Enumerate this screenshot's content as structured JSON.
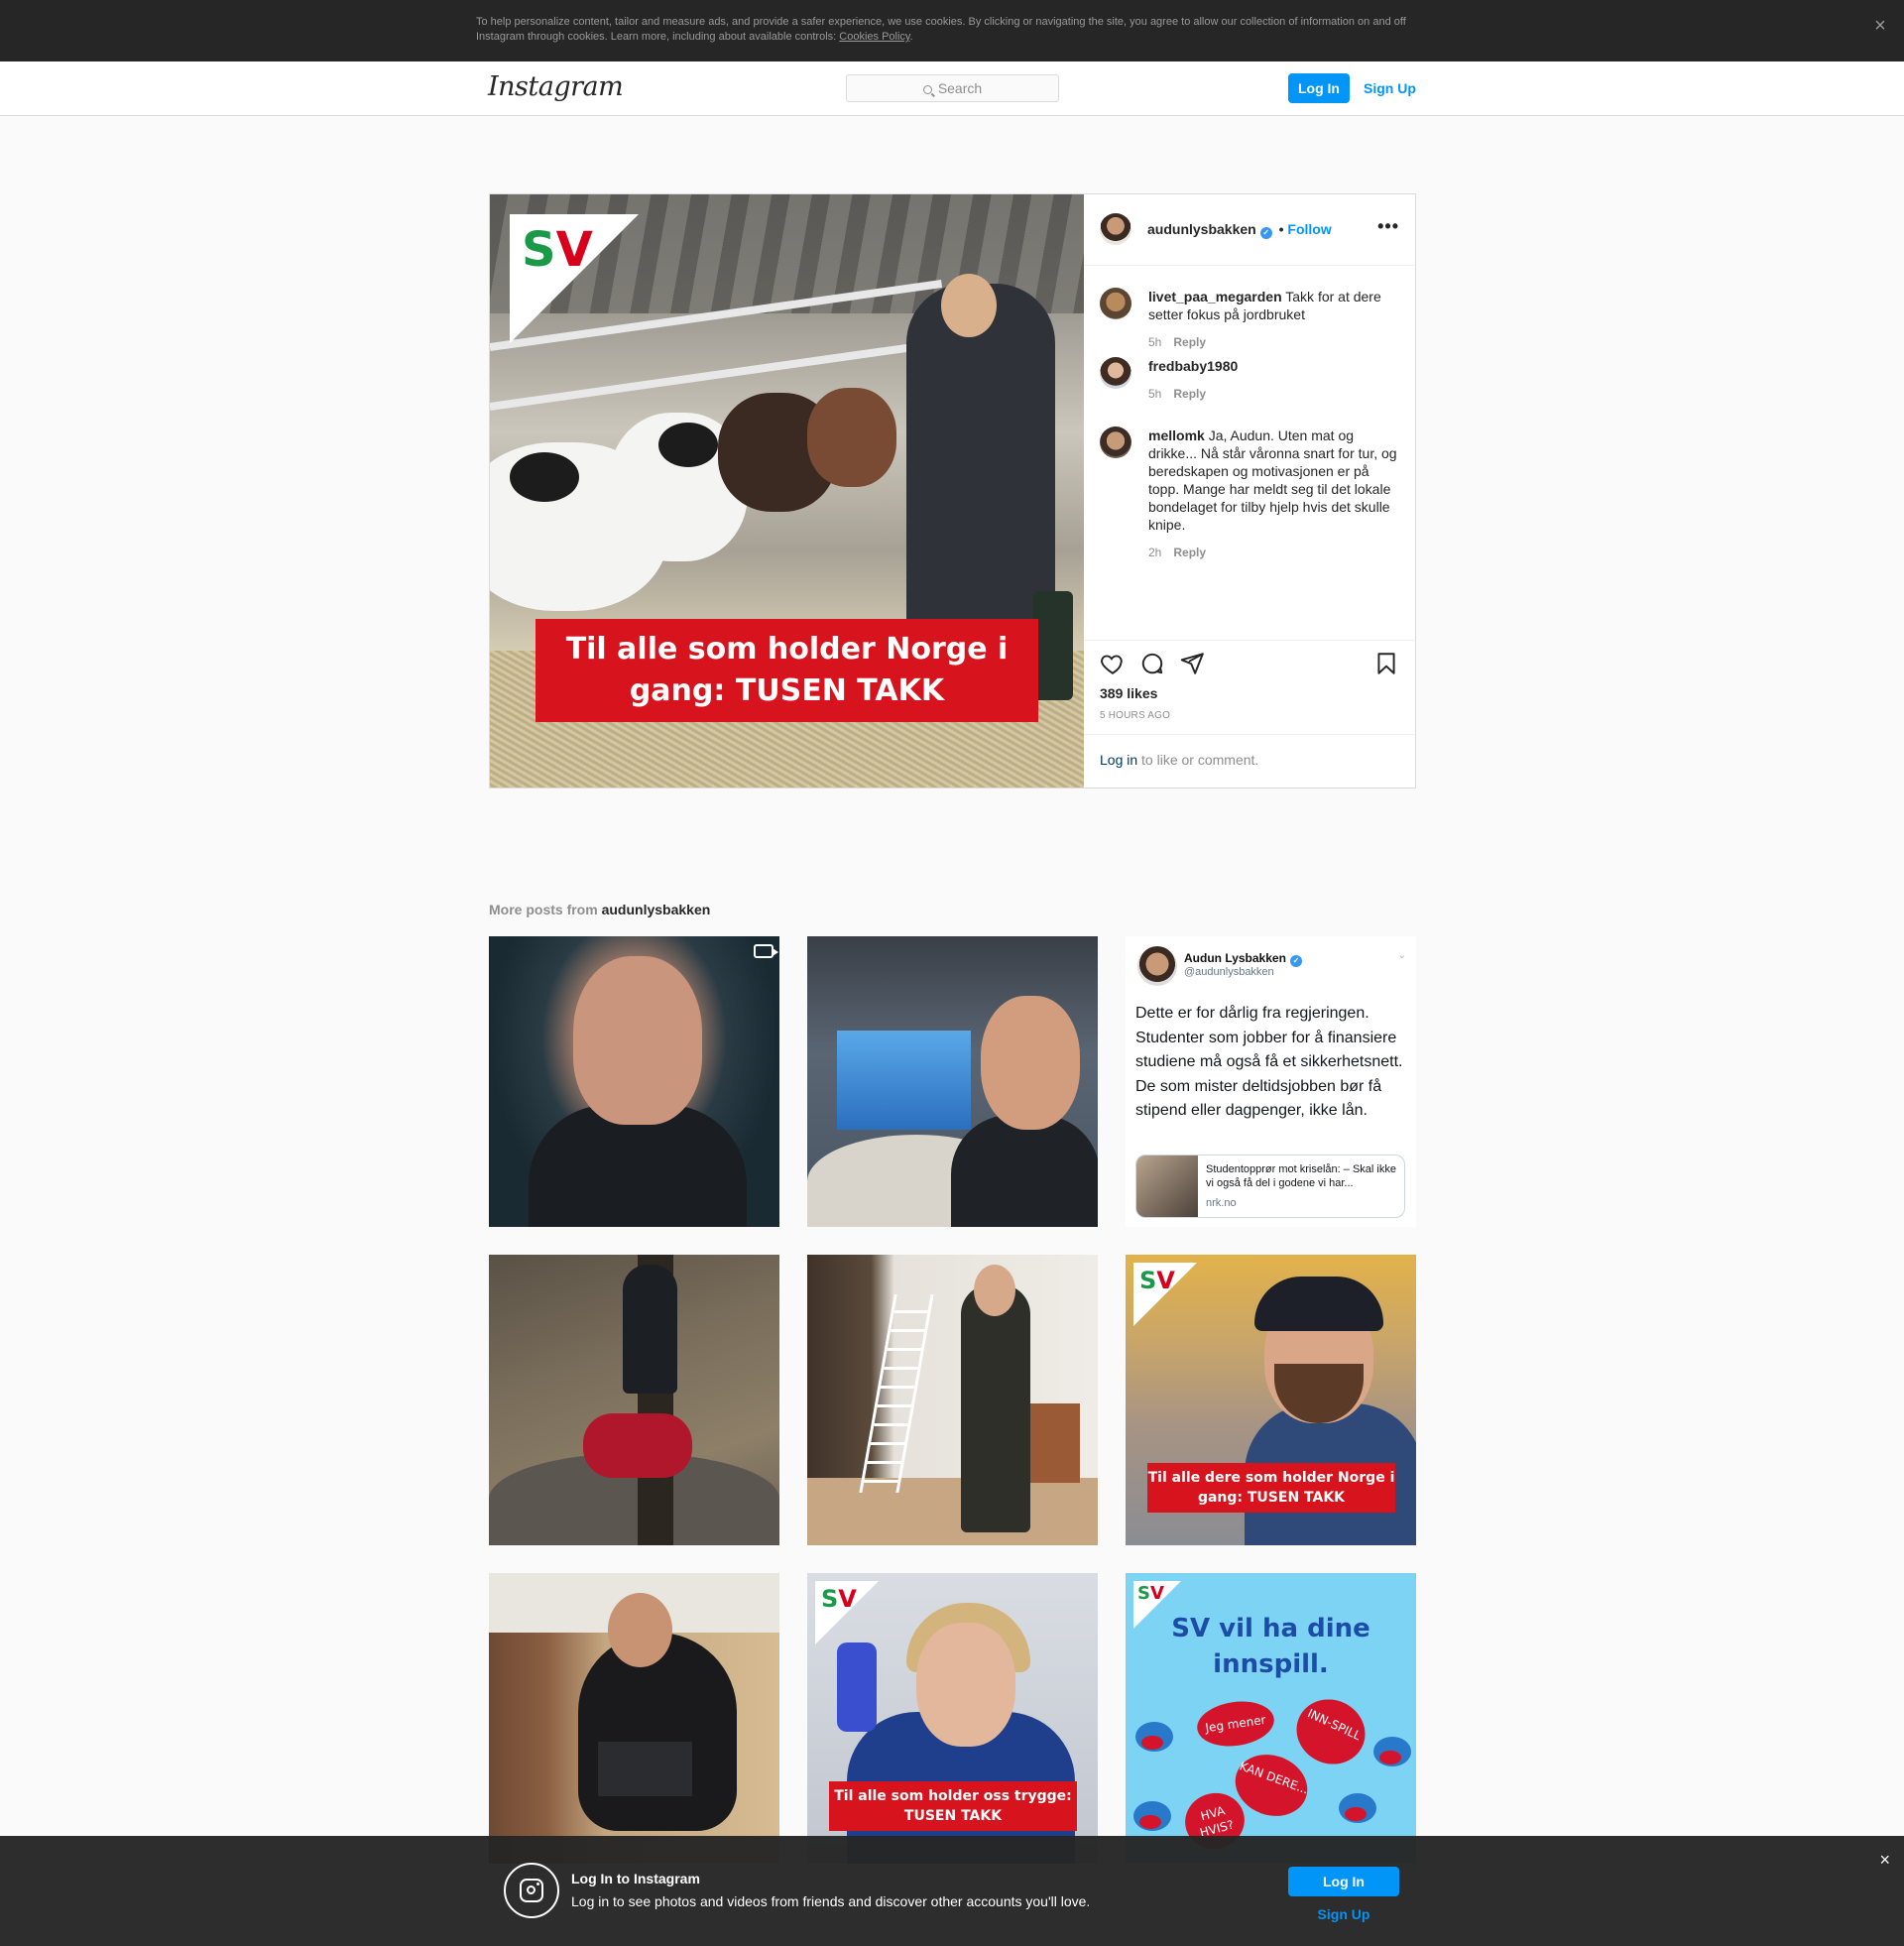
{
  "cookie_banner": {
    "text": "To help personalize content, tailor and measure ads, and provide a safer experience, we use cookies. By clicking or navigating the site, you agree to allow our collection of information on and off Instagram through cookies. Learn more, including about available controls: ",
    "link": "Cookies Policy",
    "suffix": ".",
    "close": "×"
  },
  "header": {
    "logo": "Instagram",
    "search_placeholder": "Search",
    "login": "Log In",
    "signup": "Sign Up"
  },
  "post": {
    "image_banner": "Til alle som holder Norge i gang: TUSEN TAKK",
    "author": "audunlysbakken",
    "verified_icon": "✓",
    "follow_sep": "•",
    "follow": "Follow",
    "more": "•••",
    "comments": [
      {
        "user": "livet_paa_megarden",
        "text": "Takk for at dere setter fokus på jordbruket    ",
        "time": "5h",
        "reply": "Reply"
      },
      {
        "user": "fredbaby1980",
        "text": "",
        "time": "5h",
        "reply": "Reply"
      },
      {
        "user": "mellomk",
        "text": "Ja, Audun. Uten mat og drikke... Nå står våronna snart for tur, og beredskapen og motivasjonen er på topp. Mange har meldt seg til det lokale bondelaget for tilby hjelp hvis det skulle knipe.",
        "time": "2h",
        "reply": "Reply"
      }
    ],
    "likes": "389 likes",
    "time_ago": "5 HOURS AGO",
    "login_link": "Log in",
    "login_suffix": " to like or comment."
  },
  "more_posts": {
    "label": "More posts from ",
    "user": "audunlysbakken",
    "tweet": {
      "name": "Audun Lysbakken",
      "handle": "@audunlysbakken",
      "body": "Dette er for dårlig fra regjeringen. Studenter som jobber for å finansiere studiene må også få et sikkerhetsnett. De som mister deltidsjobben bør få stipend eller dagpenger, ikke lån.",
      "card_title": "Studentopprør mot kriselån: – Skal ikke vi også få del i godene vi har...",
      "card_source": "nrk.no"
    },
    "tile6_banner": "Til alle dere som holder Norge i gang: TUSEN TAKK",
    "tile8_banner": "Til alle som holder oss trygge: TUSEN TAKK",
    "tile9_title": "SV vil ha dine innspill.",
    "tile9_bubbles": [
      "Jeg mener",
      "INN-SPILL",
      "KAN DERE...",
      "HVA HVIS?"
    ]
  },
  "sv_logo": {
    "s": "S",
    "v": "V"
  },
  "bottom_bar": {
    "title": "Log In to Instagram",
    "subtitle": "Log in to see photos and videos from friends and discover other accounts you'll love.",
    "login": "Log In",
    "signup": "Sign Up",
    "close": "×"
  },
  "colors": {
    "accent": "#0095f6",
    "sv_red": "#d7141d",
    "sv_green": "#1a9a48"
  }
}
